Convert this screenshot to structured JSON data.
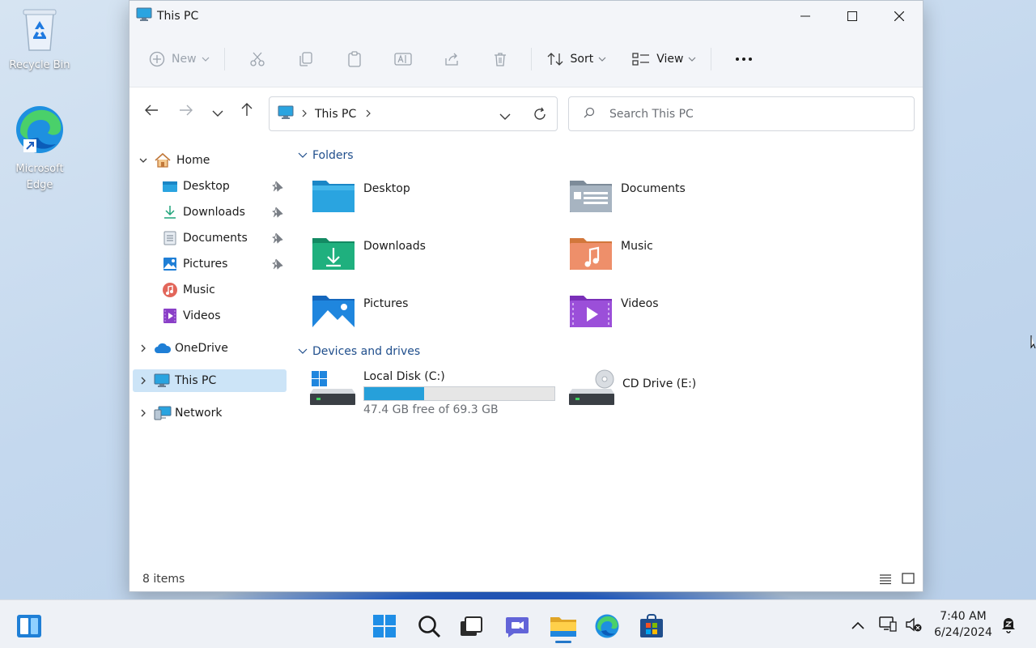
{
  "desktop": {
    "icons": [
      {
        "label": "Recycle Bin"
      },
      {
        "label": "Microsoft Edge"
      }
    ]
  },
  "window": {
    "title": "This PC",
    "controls": {
      "minimize": "minimize",
      "maximize": "maximize",
      "close": "close"
    }
  },
  "toolbar": {
    "new_label": "New",
    "sort_label": "Sort",
    "view_label": "View"
  },
  "address": {
    "segment": "This PC"
  },
  "search": {
    "placeholder": "Search This PC"
  },
  "sidebar": {
    "items": [
      {
        "label": "Home"
      },
      {
        "label": "Desktop"
      },
      {
        "label": "Downloads"
      },
      {
        "label": "Documents"
      },
      {
        "label": "Pictures"
      },
      {
        "label": "Music"
      },
      {
        "label": "Videos"
      },
      {
        "label": "OneDrive"
      },
      {
        "label": "This PC"
      },
      {
        "label": "Network"
      }
    ]
  },
  "main": {
    "folders_header": "Folders",
    "folders": [
      {
        "name": "Desktop"
      },
      {
        "name": "Documents"
      },
      {
        "name": "Downloads"
      },
      {
        "name": "Music"
      },
      {
        "name": "Pictures"
      },
      {
        "name": "Videos"
      }
    ],
    "drives_header": "Devices and drives",
    "drives": [
      {
        "name": "Local Disk (C:)",
        "free_text": "47.4 GB free of 69.3 GB",
        "used_fraction": 0.316
      },
      {
        "name": "CD Drive (E:)"
      }
    ]
  },
  "status": {
    "count": "8 items"
  },
  "taskbar": {
    "time": "7:40 AM",
    "date": "6/24/2024"
  },
  "colors": {
    "accent": "#26a0da",
    "selection": "#cce4f7",
    "section_header": "#1f4e8c"
  }
}
